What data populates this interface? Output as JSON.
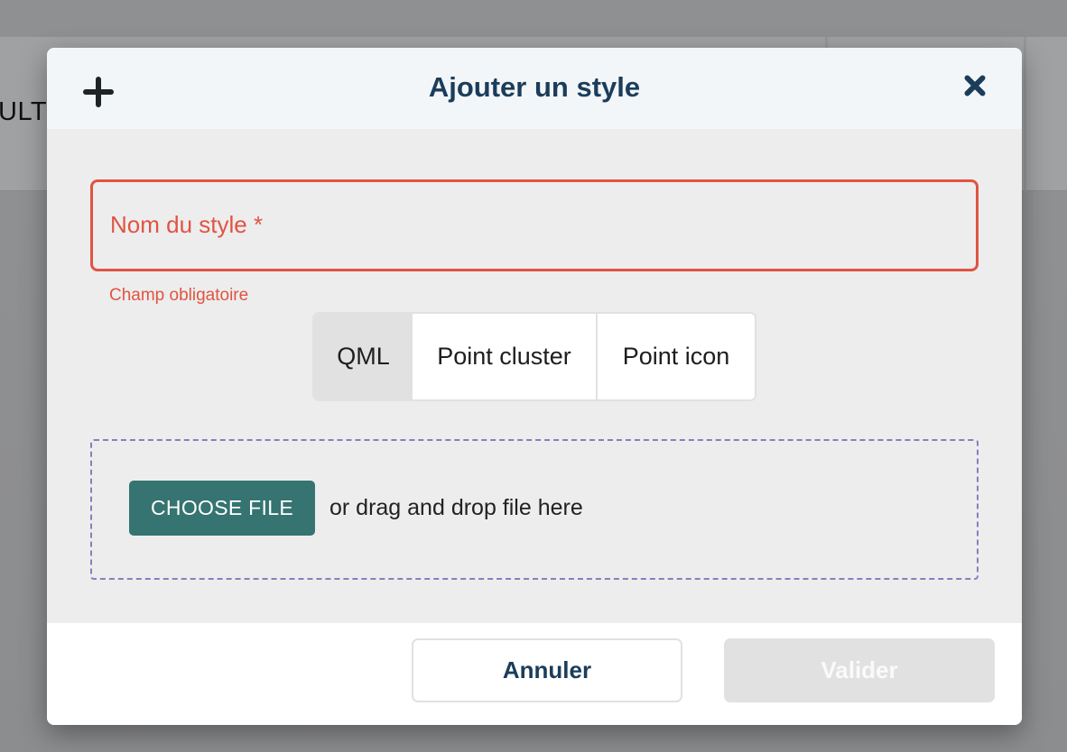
{
  "background": {
    "partial_text": "ULT"
  },
  "modal": {
    "title": "Ajouter un style",
    "header_icon": "plus-icon",
    "close_icon": "close-icon",
    "name_field": {
      "label": "Nom du style *",
      "value": "",
      "required": true,
      "error": "Champ obligatoire"
    },
    "style_types": {
      "options": [
        {
          "label": "QML",
          "selected": true
        },
        {
          "label": "Point cluster",
          "selected": false
        },
        {
          "label": "Point icon",
          "selected": false
        }
      ]
    },
    "dropzone": {
      "button_label": "CHOOSE FILE",
      "hint": "or drag and drop file here"
    },
    "footer": {
      "cancel_label": "Annuler",
      "validate_label": "Valider",
      "validate_disabled": true
    }
  },
  "colors": {
    "title": "#1b3d5a",
    "error": "#e05443",
    "primary_button": "#357470",
    "dropzone_border": "#8381bd",
    "disabled_button": "#e1e1e1"
  }
}
